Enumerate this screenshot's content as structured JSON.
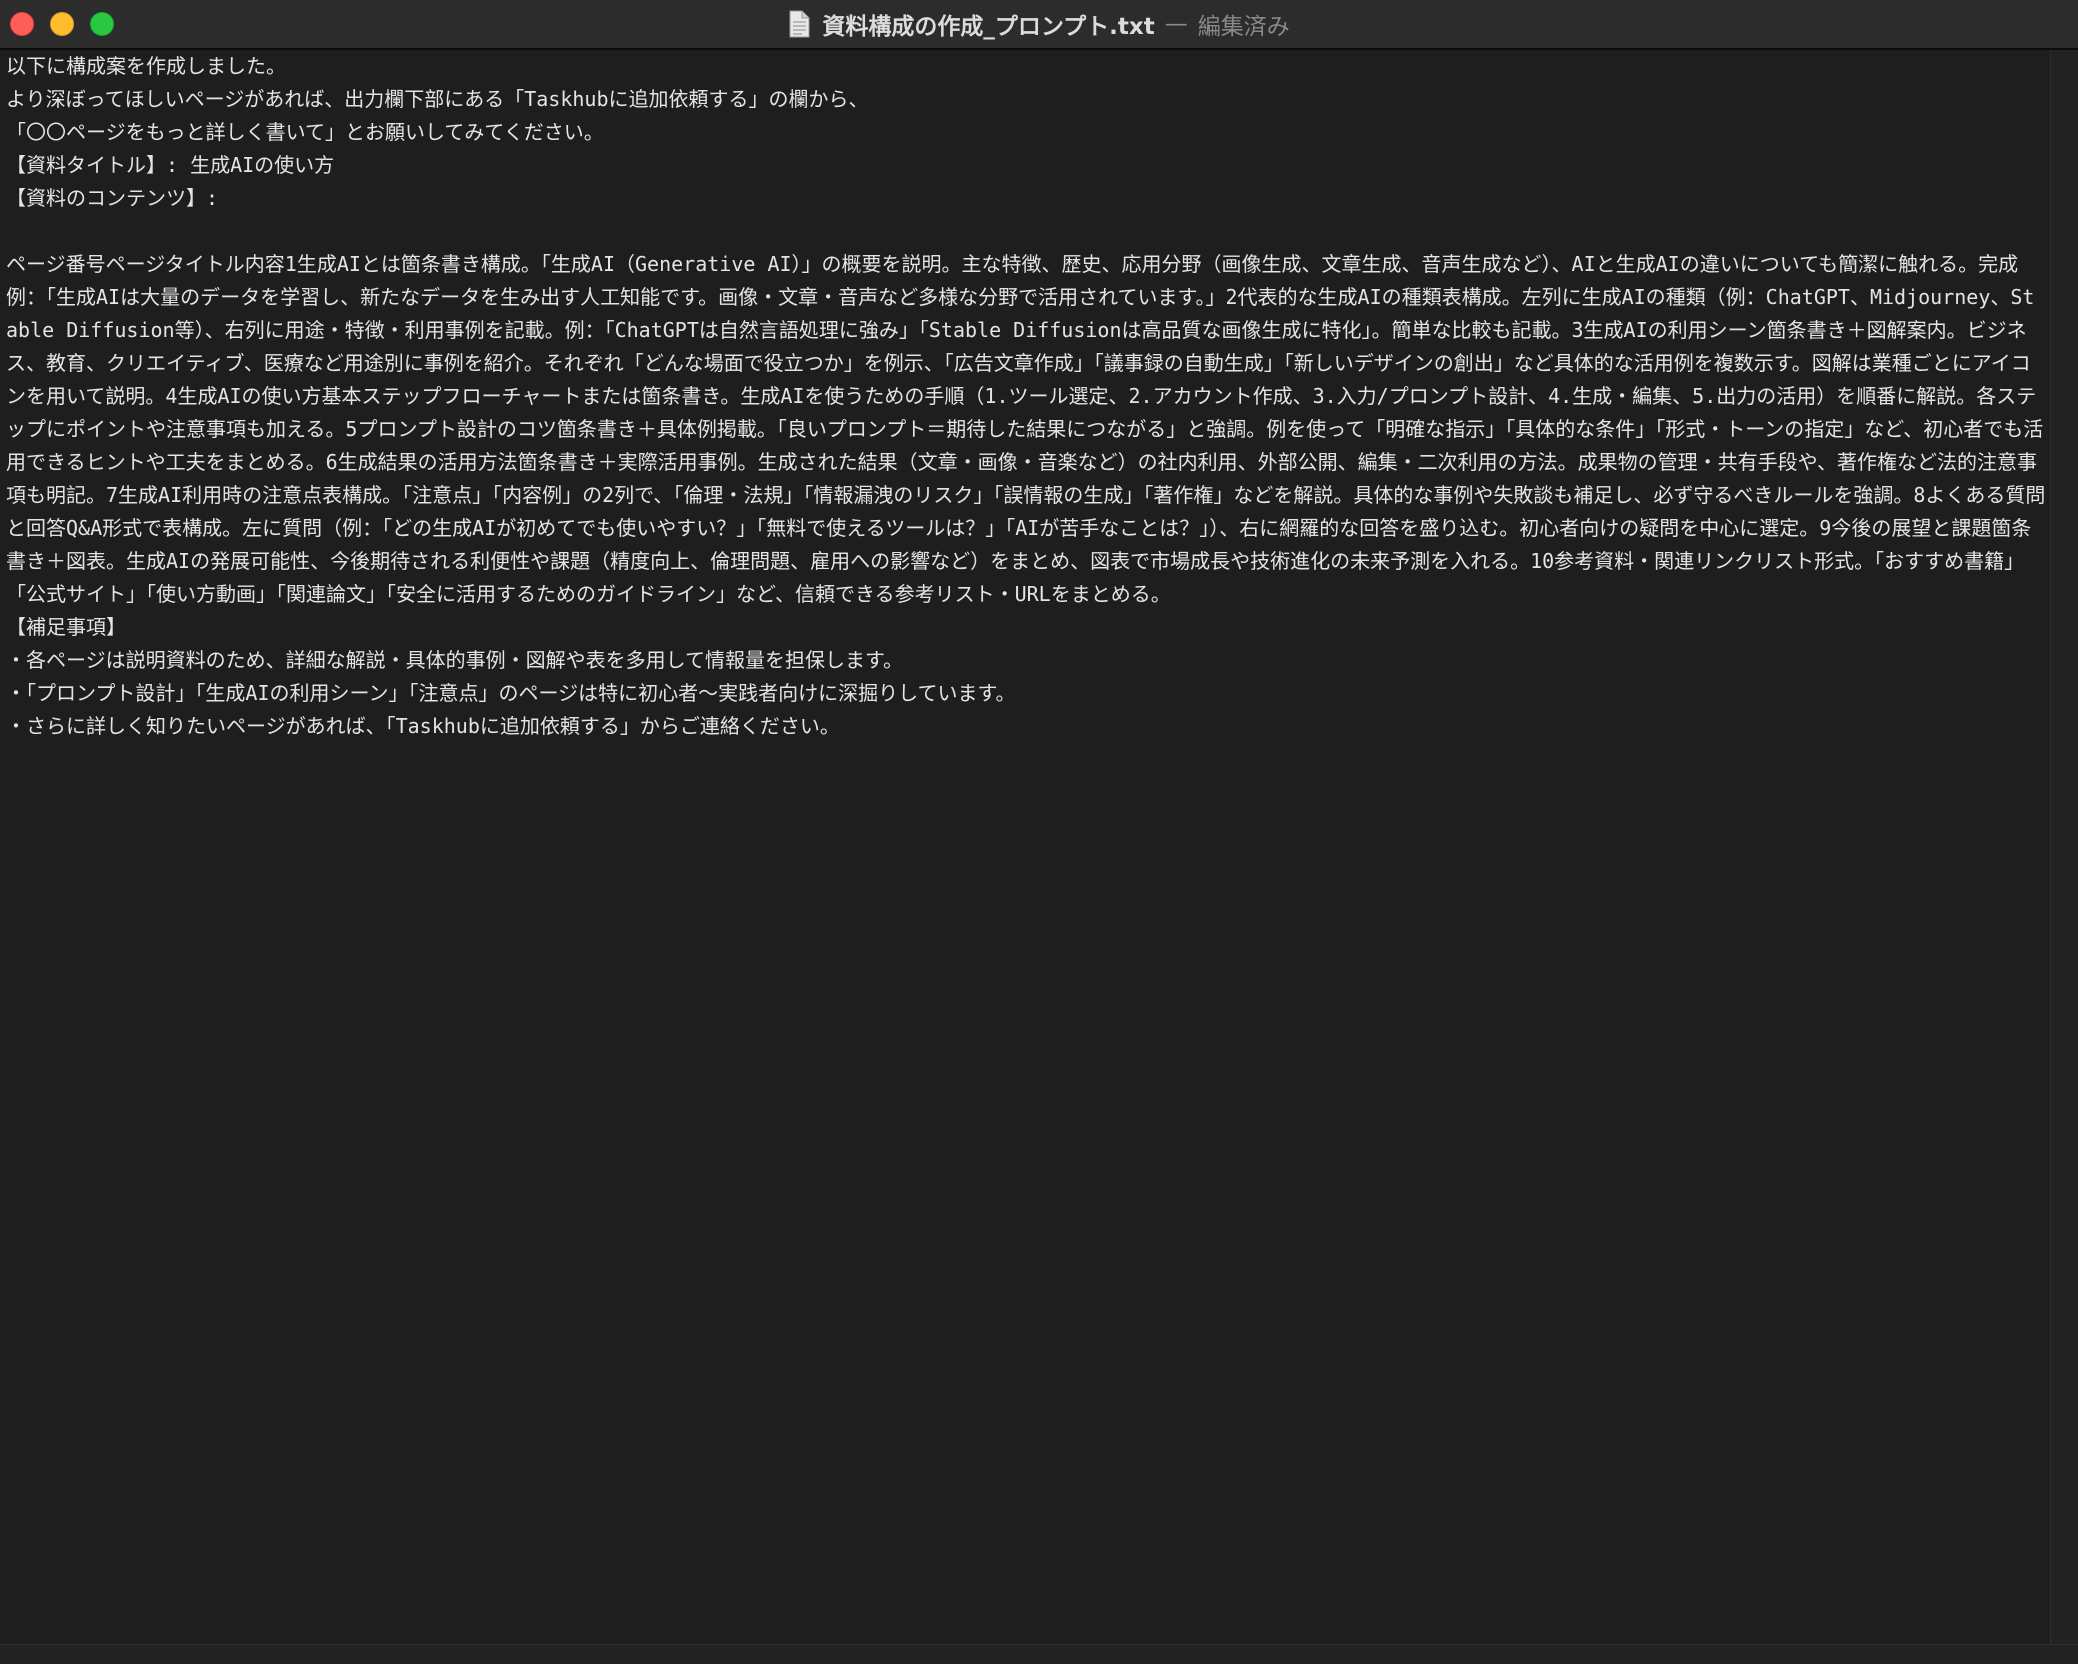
{
  "window": {
    "filename": "資料構成の作成_プロンプト.txt",
    "separator": "—",
    "status": "編集済み"
  },
  "document": {
    "lines": [
      "以下に構成案を作成しました。",
      "より深ぼってほしいページがあれば、出力欄下部にある「Taskhubに追加依頼する」の欄から、",
      "「〇〇ページをもっと詳しく書いて」とお願いしてみてください。",
      "【資料タイトル】: 生成AIの使い方",
      "【資料のコンテンツ】:",
      "",
      "ページ番号ページタイトル内容1生成AIとは箇条書き構成。「生成AI（Generative AI）」の概要を説明。主な特徴、歴史、応用分野（画像生成、文章生成、音声生成など）、AIと生成AIの違いについても簡潔に触れる。完成例：「生成AIは大量のデータを学習し、新たなデータを生み出す人工知能です。画像・文章・音声など多様な分野で活用されています。」2代表的な生成AIの種類表構成。左列に生成AIの種類（例：ChatGPT、Midjourney、Stable Diffusion等）、右列に用途・特徴・利用事例を記載。例：「ChatGPTは自然言語処理に強み」「Stable Diffusionは高品質な画像生成に特化」。簡単な比較も記載。3生成AIの利用シーン箇条書き＋図解案内。ビジネス、教育、クリエイティブ、医療など用途別に事例を紹介。それぞれ「どんな場面で役立つか」を例示、「広告文章作成」「議事録の自動生成」「新しいデザインの創出」など具体的な活用例を複数示す。図解は業種ごとにアイコンを用いて説明。4生成AIの使い方基本ステップフローチャートまたは箇条書き。生成AIを使うための手順（1.ツール選定、2.アカウント作成、3.入力/プロンプト設計、4.生成・編集、5.出力の活用）を順番に解説。各ステップにポイントや注意事項も加える。5プロンプト設計のコツ箇条書き＋具体例掲載。「良いプロンプト＝期待した結果につながる」と強調。例を使って「明確な指示」「具体的な条件」「形式・トーンの指定」など、初心者でも活用できるヒントや工夫をまとめる。6生成結果の活用方法箇条書き＋実際活用事例。生成された結果（文章・画像・音楽など）の社内利用、外部公開、編集・二次利用の方法。成果物の管理・共有手段や、著作権など法的注意事項も明記。7生成AI利用時の注意点表構成。「注意点」「内容例」の2列で、「倫理・法規」「情報漏洩のリスク」「誤情報の生成」「著作権」などを解説。具体的な事例や失敗談も補足し、必ず守るべきルールを強調。8よくある質問と回答Q&A形式で表構成。左に質問（例：「どの生成AIが初めてでも使いやすい？」「無料で使えるツールは？」「AIが苦手なことは？」）、右に網羅的な回答を盛り込む。初心者向けの疑問を中心に選定。9今後の展望と課題箇条書き＋図表。生成AIの発展可能性、今後期待される利便性や課題（精度向上、倫理問題、雇用への影響など）をまとめ、図表で市場成長や技術進化の未来予測を入れる。10参考資料・関連リンクリスト形式。「おすすめ書籍」「公式サイト」「使い方動画」「関連論文」「安全に活用するためのガイドライン」など、信頼できる参考リスト・URLをまとめる。",
      "【補足事項】",
      "・各ページは説明資料のため、詳細な解説・具体的事例・図解や表を多用して情報量を担保します。",
      "・「プロンプト設計」「生成AIの利用シーン」「注意点」のページは特に初心者〜実践者向けに深掘りしています。",
      "・さらに詳しく知りたいページがあれば、「Taskhubに追加依頼する」からご連絡ください。"
    ]
  },
  "icons": {
    "close": "close-button",
    "minimize": "minimize-button",
    "maximize": "zoom-button",
    "file": "document-icon"
  },
  "colors": {
    "background": "#1e1e1e",
    "text": "#e4e4e4",
    "titlebar": "#2c2c2c",
    "close": "#ff5f57",
    "minimize": "#febc2e",
    "maximize": "#28c840"
  }
}
